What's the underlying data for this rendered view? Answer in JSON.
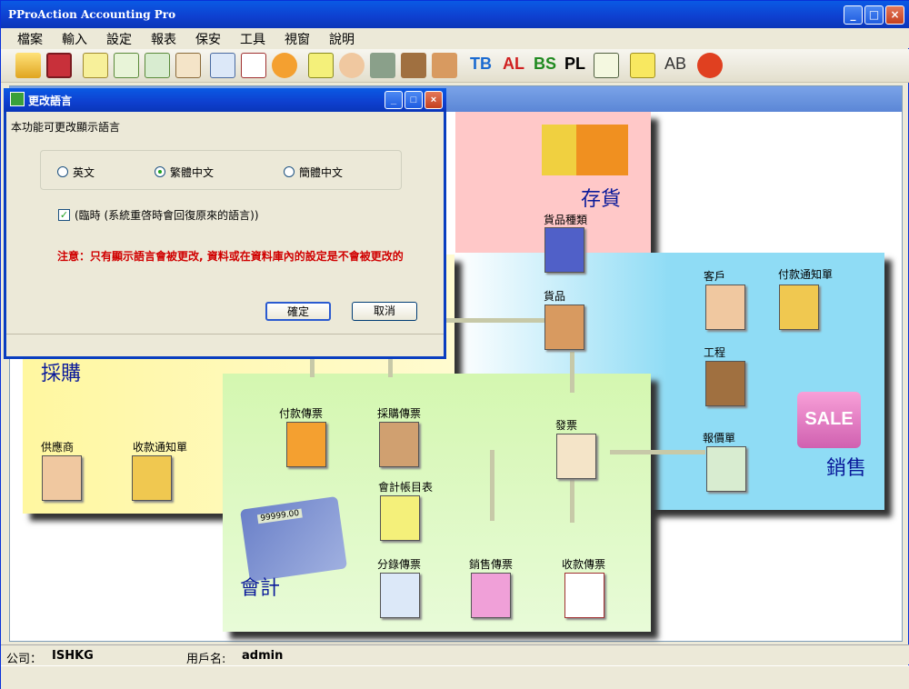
{
  "window": {
    "title": "PProAction Accounting Pro",
    "min": "_",
    "max": "□",
    "close": "×"
  },
  "menu": [
    "檔案",
    "輸入",
    "設定",
    "報表",
    "保安",
    "工具",
    "視窗",
    "說明"
  ],
  "toolbar": {
    "tb": "TB",
    "al": "AL",
    "bs": "BS",
    "pl": "PL",
    "ab": "AB"
  },
  "diagram": {
    "inventory": {
      "title": "存貨",
      "item_types": "貨品種類",
      "goods": "貨品"
    },
    "sales": {
      "title": "銷售",
      "customer": "客戶",
      "payment_notice": "付款通知單",
      "project": "工程",
      "quotation": "報價單",
      "sale_badge": "SALE"
    },
    "purchase": {
      "title": "採購",
      "supplier": "供應商",
      "receipt_notice": "收款通知單"
    },
    "accounting": {
      "title": "會計",
      "payment_voucher": "付款傳票",
      "purchase_voucher": "採購傳票",
      "chart_of_accounts": "會計帳目表",
      "journal_voucher": "分錄傳票",
      "sales_voucher": "銷售傳票",
      "receipt_voucher": "收款傳票",
      "invoice": "發票",
      "calc_display": "99999.00"
    }
  },
  "status": {
    "company_label": "公司：",
    "company": "ISHKG",
    "user_label": "用戶名:",
    "user": "admin"
  },
  "dialog": {
    "title": "更改語言",
    "description": "本功能可更改顯示語言",
    "options": [
      "英文",
      "繁體中文",
      "簡體中文"
    ],
    "selected": "繁體中文",
    "temp_label": "(臨時 (系統重啓時會回復原來的語言))",
    "temp_checked": true,
    "note": "注意：只有顯示語言會被更改, 資料或在資料庫內的設定是不會被更改的",
    "ok": "確定",
    "cancel": "取消"
  },
  "colors": {
    "title_blue": "#0e3fcf",
    "inventory_bg": "#ffc8c8",
    "sales_bg": "#8fdcf5",
    "purchase_bg": "#fff7a0",
    "accounting_bg": "#d4f7b0",
    "note_red": "#d00000"
  }
}
